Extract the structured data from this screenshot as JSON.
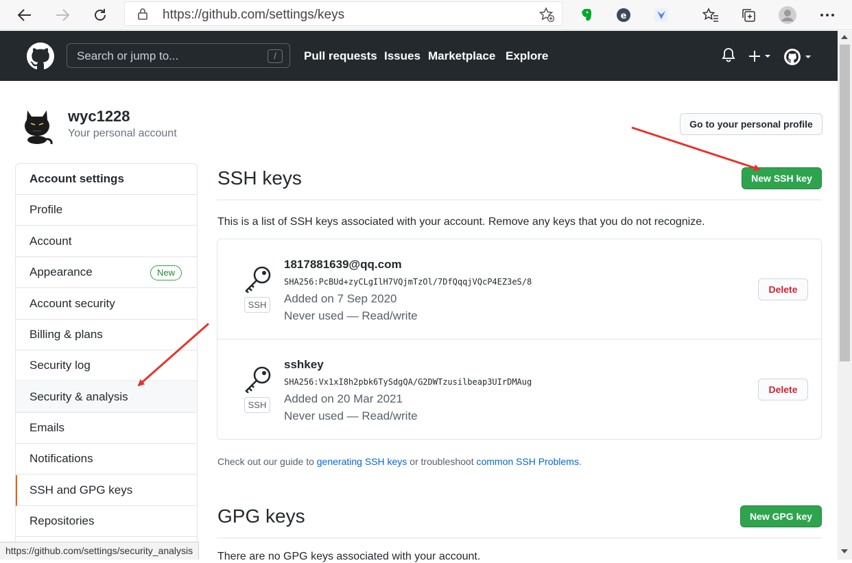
{
  "browser": {
    "url": "https://github.com/settings/keys",
    "status_url": "https://github.com/settings/security_analysis"
  },
  "header": {
    "search_placeholder": "Search or jump to...",
    "search_shortcut": "/",
    "nav": [
      "Pull requests",
      "Issues",
      "Marketplace",
      "Explore"
    ]
  },
  "account": {
    "username": "wyc1228",
    "subtitle": "Your personal account",
    "profile_button": "Go to your personal profile"
  },
  "sidebar": {
    "heading": "Account settings",
    "items": [
      {
        "label": "Profile"
      },
      {
        "label": "Account"
      },
      {
        "label": "Appearance",
        "badge": "New"
      },
      {
        "label": "Account security"
      },
      {
        "label": "Billing & plans"
      },
      {
        "label": "Security log"
      },
      {
        "label": "Security & analysis"
      },
      {
        "label": "Emails"
      },
      {
        "label": "Notifications"
      },
      {
        "label": "SSH and GPG keys"
      },
      {
        "label": "Repositories"
      }
    ]
  },
  "ssh": {
    "title": "SSH keys",
    "new_button": "New SSH key",
    "intro": "This is a list of SSH keys associated with your account. Remove any keys that you do not recognize.",
    "keys": [
      {
        "tag": "SSH",
        "title": "1817881639@qq.com",
        "fingerprint": "SHA256:PcBUd+zyCLgIlH7VQjmTzOl/7DfQqqjVQcP4EZ3eS/8",
        "added": "Added on 7 Sep 2020",
        "used": "Never used — Read/write",
        "delete": "Delete"
      },
      {
        "tag": "SSH",
        "title": "sshkey",
        "fingerprint": "SHA256:Vx1xI8h2pbk6TySdgQA/G2DWTzusilbeap3UIrDMAug",
        "added": "Added on 20 Mar 2021",
        "used": "Never used — Read/write",
        "delete": "Delete"
      }
    ],
    "guide": {
      "prefix": "Check out our guide to ",
      "link1": "generating SSH keys",
      "middle": " or troubleshoot ",
      "link2": "common SSH Problems",
      "suffix": "."
    }
  },
  "gpg": {
    "title": "GPG keys",
    "new_button": "New GPG key",
    "empty": "There are no GPG keys associated with your account."
  },
  "colors": {
    "header_bg": "#24292e",
    "green": "#2ea44f",
    "link": "#0366d6",
    "danger": "#cb2431",
    "selected_marker": "#e36209",
    "annotation": "#e8322b"
  }
}
